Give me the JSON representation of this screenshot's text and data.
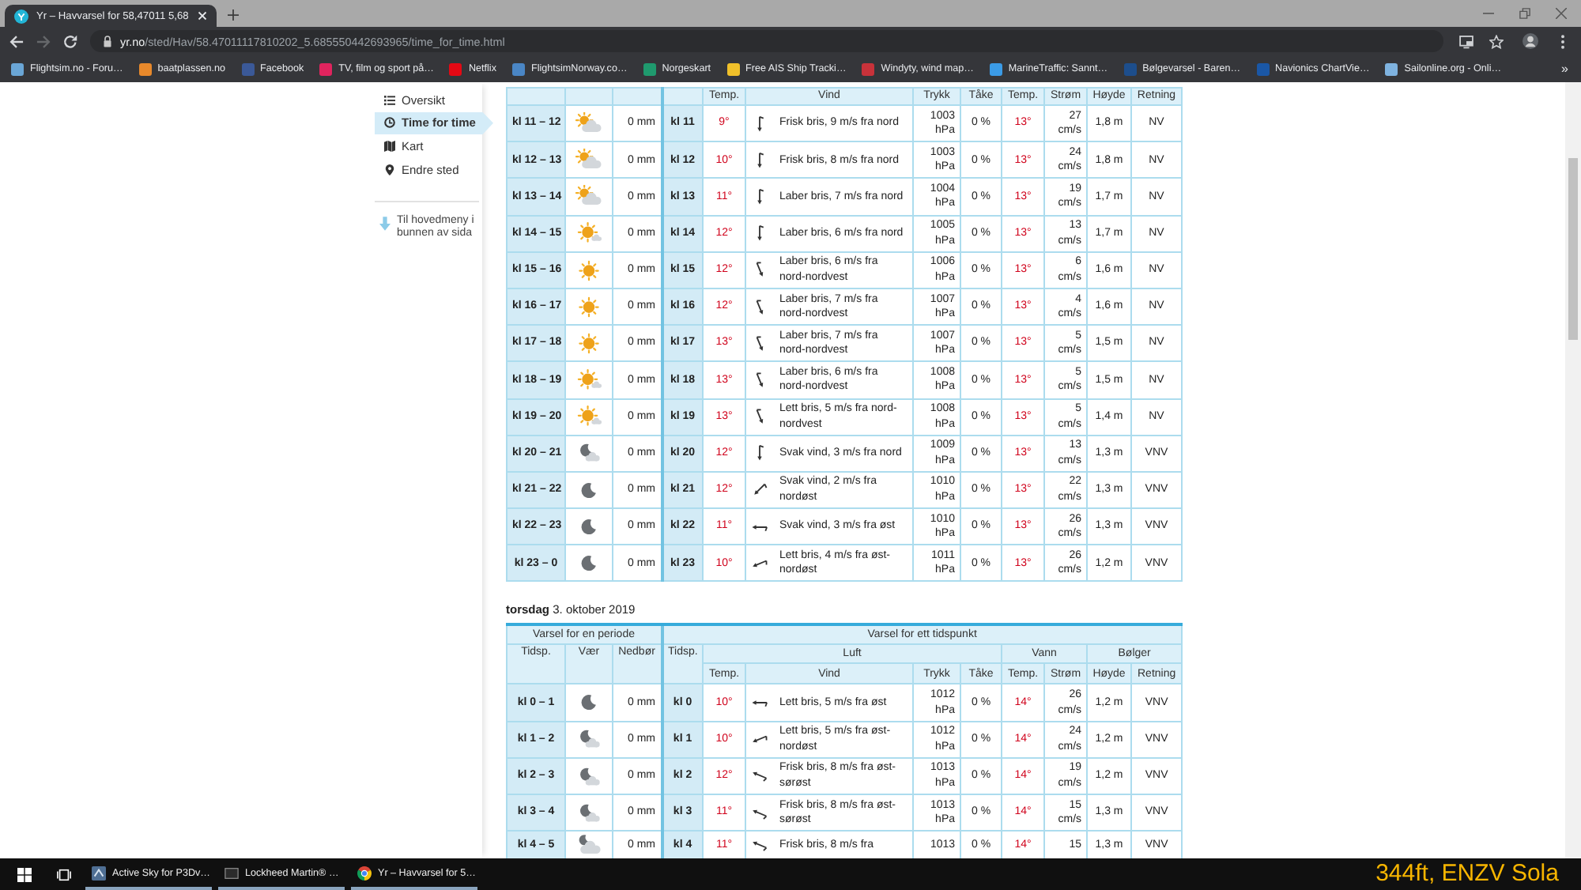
{
  "tab": {
    "title": "Yr – Havvarsel for 58,47011 5,68"
  },
  "nav_buttons": [
    {
      "kind": "back",
      "disabled": false
    },
    {
      "kind": "forward",
      "disabled": true
    },
    {
      "kind": "reload",
      "disabled": false
    }
  ],
  "address_bar": {
    "host": "yr.no",
    "path": "/sted/Hav/58.47011117810202_5.685550442693965/time_for_time.html"
  },
  "bookmarks": [
    {
      "label": "Flightsim.no - Foru…",
      "color": "#6aa6d6"
    },
    {
      "label": "baatplassen.no",
      "color": "#e8892b"
    },
    {
      "label": "Facebook",
      "color": "#3b5998"
    },
    {
      "label": "TV, film og sport på…",
      "color": "#e0245e"
    },
    {
      "label": "Netflix",
      "color": "#e50914"
    },
    {
      "label": "FlightsimNorway.co…",
      "color": "#4a86c5"
    },
    {
      "label": "Norgeskart",
      "color": "#1f9a6e"
    },
    {
      "label": "Free AIS Ship Tracki…",
      "color": "#f0c02a"
    },
    {
      "label": "Windyty, wind map…",
      "color": "#c8323a"
    },
    {
      "label": "MarineTraffic: Sannt…",
      "color": "#3b9be6"
    },
    {
      "label": "Bølgevarsel - Baren…",
      "color": "#1d4e8c"
    },
    {
      "label": "Navionics ChartVie…",
      "color": "#1a57a6"
    },
    {
      "label": "Sailonline.org - Onli…",
      "color": "#7fb3e0"
    }
  ],
  "bookmarks_more": "»",
  "sidebar": {
    "items": [
      {
        "label": "Oversikt",
        "kind": "list",
        "selected": false
      },
      {
        "label": "Time for time",
        "kind": "clock",
        "selected": true
      },
      {
        "label": "Kart",
        "kind": "map",
        "selected": false
      },
      {
        "label": "Endre sted",
        "kind": "pin",
        "selected": false
      }
    ],
    "bottom_link": "Til hovedmeny i bunnen av sida"
  },
  "tables": [
    {
      "columns": [
        "Temp.",
        "Vind",
        "Trykk",
        "Tåke",
        "Temp.",
        "Strøm",
        "Høyde",
        "Retning"
      ],
      "rows": [
        {
          "period": "kl 11 – 12",
          "kind": "partly_cloudy",
          "precip": "0 mm",
          "time": "kl 11",
          "temp": "9°",
          "wind": {
            "kind": "n",
            "text": "Frisk bris, 9 m/s fra nord"
          },
          "pressure": "1003 hPa",
          "fog": "0 %",
          "water_temp": "13°",
          "current": "27 cm/s",
          "wave_height": "1,8 m",
          "wave_dir": "NV"
        },
        {
          "period": "kl 12 – 13",
          "kind": "partly_cloudy",
          "precip": "0 mm",
          "time": "kl 12",
          "temp": "10°",
          "wind": {
            "kind": "n",
            "text": "Frisk bris, 8 m/s fra nord"
          },
          "pressure": "1003 hPa",
          "fog": "0 %",
          "water_temp": "13°",
          "current": "24 cm/s",
          "wave_height": "1,8 m",
          "wave_dir": "NV"
        },
        {
          "period": "kl 13 – 14",
          "kind": "partly_cloudy",
          "precip": "0 mm",
          "time": "kl 13",
          "temp": "11°",
          "wind": {
            "kind": "n",
            "text": "Laber bris, 7 m/s fra nord"
          },
          "pressure": "1004 hPa",
          "fog": "0 %",
          "water_temp": "13°",
          "current": "19 cm/s",
          "wave_height": "1,7 m",
          "wave_dir": "NV"
        },
        {
          "period": "kl 14 – 15",
          "kind": "fair",
          "precip": "0 mm",
          "time": "kl 14",
          "temp": "12°",
          "wind": {
            "kind": "n",
            "text": "Laber bris, 6 m/s fra nord"
          },
          "pressure": "1005 hPa",
          "fog": "0 %",
          "water_temp": "13°",
          "current": "13 cm/s",
          "wave_height": "1,7 m",
          "wave_dir": "NV"
        },
        {
          "period": "kl 15 – 16",
          "kind": "clear",
          "precip": "0 mm",
          "time": "kl 15",
          "temp": "12°",
          "wind": {
            "kind": "nnw",
            "text": "Laber bris, 6 m/s fra nord-nordvest"
          },
          "pressure": "1006 hPa",
          "fog": "0 %",
          "water_temp": "13°",
          "current": "6 cm/s",
          "wave_height": "1,6 m",
          "wave_dir": "NV"
        },
        {
          "period": "kl 16 – 17",
          "kind": "clear",
          "precip": "0 mm",
          "time": "kl 16",
          "temp": "12°",
          "wind": {
            "kind": "nnw",
            "text": "Laber bris, 7 m/s fra nord-nordvest"
          },
          "pressure": "1007 hPa",
          "fog": "0 %",
          "water_temp": "13°",
          "current": "4 cm/s",
          "wave_height": "1,6 m",
          "wave_dir": "NV"
        },
        {
          "period": "kl 17 – 18",
          "kind": "clear",
          "precip": "0 mm",
          "time": "kl 17",
          "temp": "13°",
          "wind": {
            "kind": "nnw",
            "text": "Laber bris, 7 m/s fra nord-nordvest"
          },
          "pressure": "1007 hPa",
          "fog": "0 %",
          "water_temp": "13°",
          "current": "5 cm/s",
          "wave_height": "1,5 m",
          "wave_dir": "NV"
        },
        {
          "period": "kl 18 – 19",
          "kind": "fair",
          "precip": "0 mm",
          "time": "kl 18",
          "temp": "13°",
          "wind": {
            "kind": "nnw",
            "text": "Laber bris, 6 m/s fra nord-nordvest"
          },
          "pressure": "1008 hPa",
          "fog": "0 %",
          "water_temp": "13°",
          "current": "5 cm/s",
          "wave_height": "1,5 m",
          "wave_dir": "NV"
        },
        {
          "period": "kl 19 – 20",
          "kind": "fair",
          "precip": "0 mm",
          "time": "kl 19",
          "temp": "13°",
          "wind": {
            "kind": "nnw",
            "text": "Lett bris, 5 m/s fra nord-nordvest"
          },
          "pressure": "1008 hPa",
          "fog": "0 %",
          "water_temp": "13°",
          "current": "5 cm/s",
          "wave_height": "1,4 m",
          "wave_dir": "NV"
        },
        {
          "period": "kl 20 – 21",
          "kind": "night_partly_cloudy",
          "precip": "0 mm",
          "time": "kl 20",
          "temp": "12°",
          "wind": {
            "kind": "n",
            "text": "Svak vind, 3 m/s fra nord"
          },
          "pressure": "1009 hPa",
          "fog": "0 %",
          "water_temp": "13°",
          "current": "13 cm/s",
          "wave_height": "1,3 m",
          "wave_dir": "VNV"
        },
        {
          "period": "kl 21 – 22",
          "kind": "night_clear",
          "precip": "0 mm",
          "time": "kl 21",
          "temp": "12°",
          "wind": {
            "kind": "ne",
            "text": "Svak vind, 2 m/s fra nordøst"
          },
          "pressure": "1010 hPa",
          "fog": "0 %",
          "water_temp": "13°",
          "current": "22 cm/s",
          "wave_height": "1,3 m",
          "wave_dir": "VNV"
        },
        {
          "period": "kl 22 – 23",
          "kind": "night_clear",
          "precip": "0 mm",
          "time": "kl 22",
          "temp": "11°",
          "wind": {
            "kind": "e",
            "text": "Svak vind, 3 m/s fra øst"
          },
          "pressure": "1010 hPa",
          "fog": "0 %",
          "water_temp": "13°",
          "current": "26 cm/s",
          "wave_height": "1,3 m",
          "wave_dir": "VNV"
        },
        {
          "period": "kl 23 – 0",
          "kind": "night_clear",
          "precip": "0 mm",
          "time": "kl 23",
          "temp": "10°",
          "wind": {
            "kind": "ene",
            "text": "Lett bris, 4 m/s fra øst-nordøst"
          },
          "pressure": "1011 hPa",
          "fog": "0 %",
          "water_temp": "13°",
          "current": "26 cm/s",
          "wave_height": "1,2 m",
          "wave_dir": "VNV"
        }
      ]
    },
    {
      "day_heading": "**torsdag** 3. oktober 2019",
      "groups": [
        "Varsel for en periode",
        "Varsel for ett tidspunkt"
      ],
      "fixed_columns": [
        "Tidsp.",
        "Vær",
        "Nedbør",
        "Tidsp."
      ],
      "subgroups": [
        "Luft",
        "Vann",
        "Bølger"
      ],
      "columns": [
        "Temp.",
        "Vind",
        "Trykk",
        "Tåke",
        "Temp.",
        "Strøm",
        "Høyde",
        "Retning"
      ],
      "rows": [
        {
          "period": "kl 0 – 1",
          "kind": "night_clear",
          "precip": "0 mm",
          "time": "kl 0",
          "temp": "10°",
          "wind": {
            "kind": "e",
            "text": "Lett bris, 5 m/s fra øst"
          },
          "pressure": "1012 hPa",
          "fog": "0 %",
          "water_temp": "14°",
          "current": "26 cm/s",
          "wave_height": "1,2 m",
          "wave_dir": "VNV"
        },
        {
          "period": "kl 1 – 2",
          "kind": "night_partly_cloudy",
          "precip": "0 mm",
          "time": "kl 1",
          "temp": "10°",
          "wind": {
            "kind": "ene",
            "text": "Lett bris, 5 m/s fra øst-nordøst"
          },
          "pressure": "1012 hPa",
          "fog": "0 %",
          "water_temp": "14°",
          "current": "24 cm/s",
          "wave_height": "1,2 m",
          "wave_dir": "VNV"
        },
        {
          "period": "kl 2 – 3",
          "kind": "night_partly_cloudy",
          "precip": "0 mm",
          "time": "kl 2",
          "temp": "12°",
          "wind": {
            "kind": "ese",
            "text": "Frisk bris, 8 m/s fra øst-sørøst"
          },
          "pressure": "1013 hPa",
          "fog": "0 %",
          "water_temp": "14°",
          "current": "19 cm/s",
          "wave_height": "1,2 m",
          "wave_dir": "VNV"
        },
        {
          "period": "kl 3 – 4",
          "kind": "night_partly_cloudy",
          "precip": "0 mm",
          "time": "kl 3",
          "temp": "11°",
          "wind": {
            "kind": "ese",
            "text": "Frisk bris, 8 m/s fra øst-sørøst"
          },
          "pressure": "1013 hPa",
          "fog": "0 %",
          "water_temp": "14°",
          "current": "15 cm/s",
          "wave_height": "1,3 m",
          "wave_dir": "VNV"
        },
        {
          "period": "kl 4 – 5",
          "kind": "night_cloudy",
          "precip": "0 mm",
          "time": "kl 4",
          "temp": "11°",
          "wind": {
            "kind": "ese",
            "text": "Frisk bris, 8 m/s fra"
          },
          "pressure": "1013",
          "fog": "0 %",
          "water_temp": "14°",
          "current": "15",
          "wave_height": "1,3 m",
          "wave_dir": "VNV"
        }
      ]
    }
  ],
  "taskbar": {
    "apps": [
      {
        "label": "Active Sky for P3Dv…",
        "kind": "active_sky"
      },
      {
        "label": "Lockheed Martin® …",
        "kind": "p3d"
      },
      {
        "label": "Yr – Havvarsel for 5…",
        "kind": "chrome"
      }
    ]
  },
  "sim_overlay": "344ft, ENZV Sola"
}
